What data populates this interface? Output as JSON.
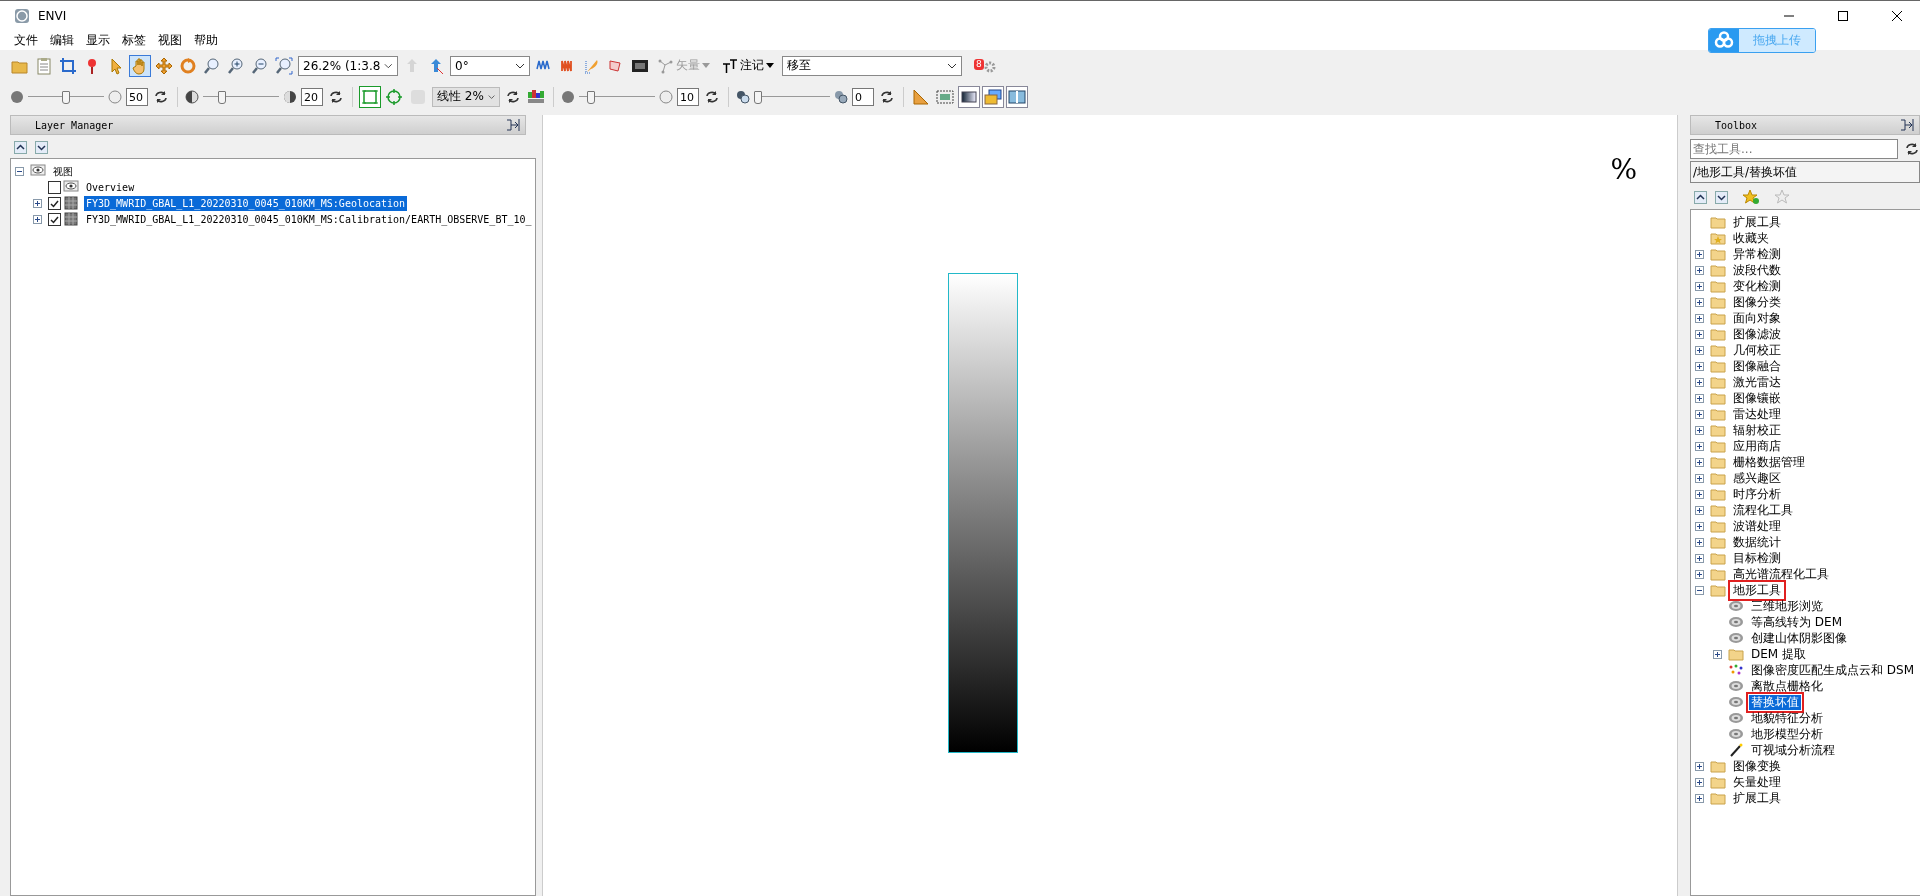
{
  "window": {
    "title": "ENVI"
  },
  "menu": [
    "文件",
    "编辑",
    "显示",
    "标签",
    "视图",
    "帮助"
  ],
  "upload_button": {
    "label": "拖拽上传"
  },
  "toolbar": {
    "tools": [
      {
        "kind": "open",
        "selected": false
      },
      {
        "kind": "clipboard",
        "selected": false
      },
      {
        "kind": "crop",
        "selected": false
      },
      {
        "kind": "pin",
        "selected": false
      },
      {
        "kind": "pointer",
        "selected": false
      },
      {
        "kind": "hand",
        "selected": true
      },
      {
        "kind": "move",
        "selected": false
      },
      {
        "kind": "rotate",
        "selected": false
      },
      {
        "kind": "zoom",
        "selected": false
      },
      {
        "kind": "zoom-in",
        "selected": false
      },
      {
        "kind": "zoom-out",
        "selected": false
      },
      {
        "kind": "zoom-fit",
        "selected": false
      }
    ],
    "zoom": "26.2% (1:3.8",
    "rotation": "0°",
    "vector": {
      "label": "矢量",
      "disabled": true
    },
    "annotation": {
      "label": "注记",
      "disabled": false
    },
    "goto": "移至",
    "badge": "8"
  },
  "adjust_bar": {
    "brightness": {
      "level": 0.5,
      "value": "50"
    },
    "contrast": {
      "level": 0.22,
      "value": "20"
    },
    "stretch": "线性 2%",
    "sharpen": {
      "level": 0.12,
      "value": "10"
    },
    "transparency": {
      "level": 0.0,
      "value": "0"
    }
  },
  "layer_manager": {
    "title": "Layer Manager",
    "tree": [
      {
        "label": "视图",
        "kind": "view",
        "expanded": true,
        "selected": false,
        "children": [
          {
            "label": "Overview",
            "kind": "view",
            "checked": false,
            "selected": false
          },
          {
            "label": "FY3D_MWRID_GBAL_L1_20220310_0045_010KM_MS:Geolocation",
            "kind": "raster",
            "expanded": false,
            "checked": true,
            "selected": true
          },
          {
            "label": "FY3D_MWRID_GBAL_L1_20220310_0045_010KM_MS:Calibration/EARTH_OBSERVE_BT_10_",
            "kind": "raster",
            "expanded": false,
            "checked": true,
            "selected": false
          }
        ]
      }
    ]
  },
  "canvas": {
    "symbol": "%"
  },
  "toolbox": {
    "title": "Toolbox",
    "search": {
      "placeholder": "查找工具..."
    },
    "path": "/地形工具/替换坏值",
    "tree": [
      {
        "label": "扩展工具",
        "kind": "folder",
        "selected": false,
        "annotated": false
      },
      {
        "label": "收藏夹",
        "kind": "favorites",
        "selected": false,
        "annotated": false
      },
      {
        "label": "异常检测",
        "kind": "folder",
        "expanded": false,
        "selected": false,
        "annotated": false
      },
      {
        "label": "波段代数",
        "kind": "folder",
        "expanded": false,
        "selected": false,
        "annotated": false
      },
      {
        "label": "变化检测",
        "kind": "folder",
        "expanded": false,
        "selected": false,
        "annotated": false
      },
      {
        "label": "图像分类",
        "kind": "folder",
        "expanded": false,
        "selected": false,
        "annotated": false
      },
      {
        "label": "面向对象",
        "kind": "folder",
        "expanded": false,
        "selected": false,
        "annotated": false
      },
      {
        "label": "图像滤波",
        "kind": "folder",
        "expanded": false,
        "selected": false,
        "annotated": false
      },
      {
        "label": "几何校正",
        "kind": "folder",
        "expanded": false,
        "selected": false,
        "annotated": false
      },
      {
        "label": "图像融合",
        "kind": "folder",
        "expanded": false,
        "selected": false,
        "annotated": false
      },
      {
        "label": "激光雷达",
        "kind": "folder",
        "expanded": false,
        "selected": false,
        "annotated": false
      },
      {
        "label": "图像镶嵌",
        "kind": "folder",
        "expanded": false,
        "selected": false,
        "annotated": false
      },
      {
        "label": "雷达处理",
        "kind": "folder",
        "expanded": false,
        "selected": false,
        "annotated": false
      },
      {
        "label": "辐射校正",
        "kind": "folder",
        "expanded": false,
        "selected": false,
        "annotated": false
      },
      {
        "label": "应用商店",
        "kind": "folder",
        "expanded": false,
        "selected": false,
        "annotated": false
      },
      {
        "label": "栅格数据管理",
        "kind": "folder",
        "expanded": false,
        "selected": false,
        "annotated": false
      },
      {
        "label": "感兴趣区",
        "kind": "folder",
        "expanded": false,
        "selected": false,
        "annotated": false
      },
      {
        "label": "时序分析",
        "kind": "folder",
        "expanded": false,
        "selected": false,
        "annotated": false
      },
      {
        "label": "流程化工具",
        "kind": "folder",
        "expanded": false,
        "selected": false,
        "annotated": false
      },
      {
        "label": "波谱处理",
        "kind": "folder",
        "expanded": false,
        "selected": false,
        "annotated": false
      },
      {
        "label": "数据统计",
        "kind": "folder",
        "expanded": false,
        "selected": false,
        "annotated": false
      },
      {
        "label": "目标检测",
        "kind": "folder",
        "expanded": false,
        "selected": false,
        "annotated": false
      },
      {
        "label": "高光谱流程化工具",
        "kind": "folder",
        "expanded": false,
        "selected": false,
        "annotated": false
      },
      {
        "label": "地形工具",
        "kind": "folder",
        "expanded": true,
        "selected": false,
        "annotated": true,
        "children": [
          {
            "label": "三维地形浏览",
            "kind": "tool",
            "selected": false,
            "annotated": false
          },
          {
            "label": "等高线转为 DEM",
            "kind": "tool",
            "selected": false,
            "annotated": false
          },
          {
            "label": "创建山体阴影图像",
            "kind": "tool",
            "selected": false,
            "annotated": false
          },
          {
            "label": "DEM 提取",
            "kind": "folder",
            "expanded": false,
            "selected": false,
            "annotated": false
          },
          {
            "label": "图像密度匹配生成点云和 DSM",
            "kind": "points",
            "selected": false,
            "annotated": false
          },
          {
            "label": "离散点栅格化",
            "kind": "tool",
            "selected": false,
            "annotated": false
          },
          {
            "label": "替换坏值",
            "kind": "tool",
            "selected": true,
            "annotated": true
          },
          {
            "label": "地貌特征分析",
            "kind": "tool",
            "selected": false,
            "annotated": false
          },
          {
            "label": "地形模型分析",
            "kind": "tool",
            "selected": false,
            "annotated": false
          },
          {
            "label": "可视域分析流程",
            "kind": "wand",
            "selected": false,
            "annotated": false
          }
        ]
      },
      {
        "label": "图像变换",
        "kind": "folder",
        "expanded": false,
        "selected": false,
        "annotated": false
      },
      {
        "label": "矢量处理",
        "kind": "folder",
        "expanded": false,
        "selected": false,
        "annotated": false
      },
      {
        "label": "扩展工具",
        "kind": "folder",
        "expanded": false,
        "selected": false,
        "annotated": false
      }
    ]
  }
}
